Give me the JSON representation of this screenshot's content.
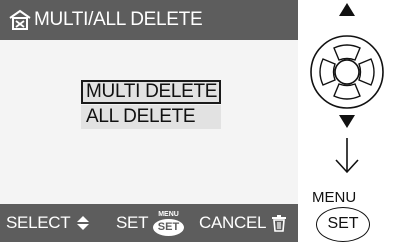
{
  "screen": {
    "title": "MULTI/ALL DELETE",
    "title_icon": "delete-menu-icon",
    "menu_items": [
      {
        "label": "MULTI DELETE",
        "selected": true
      },
      {
        "label": "ALL DELETE",
        "selected": false
      }
    ],
    "footer": {
      "select_label": "SELECT",
      "set_label": "SET",
      "badge_top": "MENU",
      "badge_bottom": "SET",
      "cancel_label": "CANCEL"
    }
  },
  "controls": {
    "menu_label": "MENU",
    "set_button_label": "SET"
  },
  "colors": {
    "bar": "#5d5d5d",
    "content": "#f4f4f4",
    "highlight": "#e2e2e2",
    "text": "#111111"
  }
}
